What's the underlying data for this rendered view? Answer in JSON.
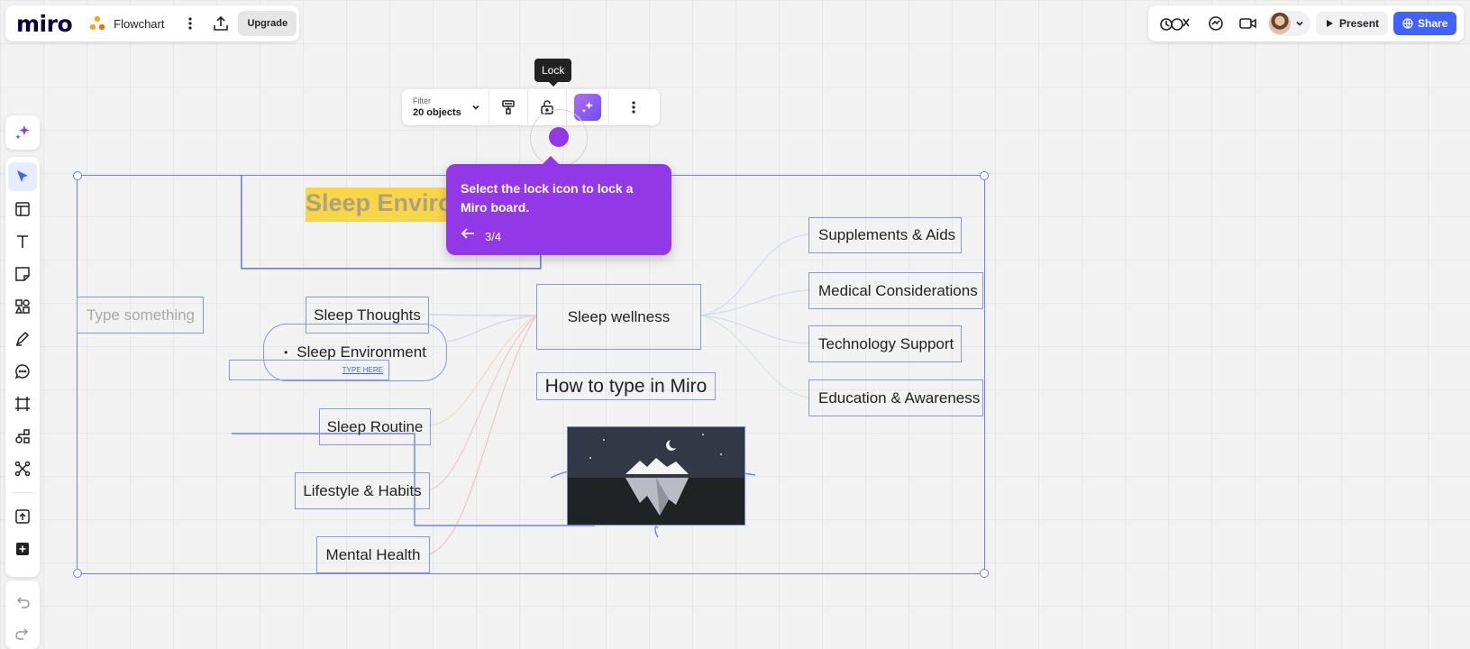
{
  "topbar": {
    "logo": "miro",
    "board_name": "Flowchart",
    "upgrade_label": "Upgrade",
    "present_label": "Present",
    "share_label": "Share"
  },
  "context_toolbar": {
    "filter_label": "Filter",
    "filter_count": "20 objects"
  },
  "tooltip": {
    "text": "Lock"
  },
  "walkthrough": {
    "text": "Select the lock icon to lock a Miro board.",
    "step": "3/4"
  },
  "board": {
    "title": "Sleep Enviro",
    "placeholder": "Type something",
    "center_node": "Sleep wellness",
    "heading": "How to type in Miro",
    "type_here": "TYPE HERE",
    "left_nodes": [
      "Sleep Thoughts",
      "Sleep Environment",
      "Sleep Routine",
      "Lifestyle & Habits",
      "Mental Health"
    ],
    "right_nodes": [
      "Supplements & Aids",
      "Medical Considerations",
      "Technology Support",
      "Education & Awareness"
    ]
  },
  "colors": {
    "accent": "#4262ff",
    "walkthrough": "#9238e6",
    "selection": "#6f82e8",
    "highlight": "#f9d548"
  }
}
